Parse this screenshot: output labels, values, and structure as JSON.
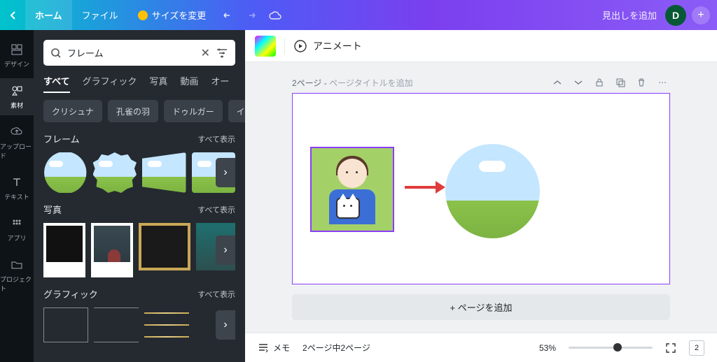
{
  "topbar": {
    "home": "ホーム",
    "file": "ファイル",
    "resize": "サイズを変更",
    "doc_title": "見出しを追加",
    "avatar_letter": "D"
  },
  "rail": {
    "design": "デザイン",
    "elements": "素材",
    "upload": "アップロード",
    "text": "テキスト",
    "apps": "アプリ",
    "project": "プロジェクト"
  },
  "search": {
    "value": "フレーム"
  },
  "tabs": {
    "all": "すべて",
    "graphics": "グラフィック",
    "photos": "写真",
    "videos": "動画",
    "audio": "オー"
  },
  "chips": {
    "c1": "クリシュナ",
    "c2": "孔雀の羽",
    "c3": "ドゥルガー",
    "c4": "イン"
  },
  "sections": {
    "frames": "フレーム",
    "photos": "写真",
    "graphics": "グラフィック",
    "see_all": "すべて表示"
  },
  "context": {
    "animate": "アニメート"
  },
  "page": {
    "label_prefix": "2ページ - ",
    "title_placeholder": "ページタイトルを追加",
    "add_page": "+ ページを追加"
  },
  "footer": {
    "notes": "メモ",
    "page_indicator": "2ページ中2ページ",
    "zoom": "53%",
    "pages_count": "2"
  }
}
